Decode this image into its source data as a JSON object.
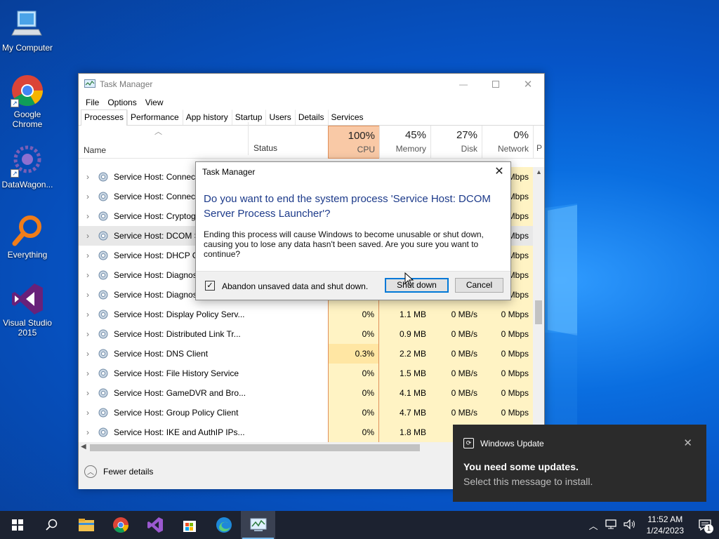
{
  "desktop": {
    "icons": [
      {
        "label": "My Computer"
      },
      {
        "label": "Google Chrome"
      },
      {
        "label": "DataWagon..."
      },
      {
        "label": "Everything"
      },
      {
        "label": "Visual Studio 2015"
      }
    ]
  },
  "taskmanager": {
    "title": "Task Manager",
    "menu": [
      "File",
      "Options",
      "View"
    ],
    "tabs": [
      "Processes",
      "Performance",
      "App history",
      "Startup",
      "Users",
      "Details",
      "Services"
    ],
    "columns": {
      "name": "Name",
      "status": "Status",
      "cpu": {
        "pct": "100%",
        "label": "CPU"
      },
      "memory": {
        "pct": "45%",
        "label": "Memory"
      },
      "disk": {
        "pct": "27%",
        "label": "Disk"
      },
      "network": {
        "pct": "0%",
        "label": "Network"
      },
      "power": "P"
    },
    "rows": [
      {
        "name": "Service Host: Connected...",
        "cpu": "",
        "mem": "",
        "disk": "",
        "net": "Mbps"
      },
      {
        "name": "Service Host: Connected...",
        "cpu": "",
        "mem": "",
        "disk": "",
        "net": "Mbps"
      },
      {
        "name": "Service Host: Cryptogr...",
        "cpu": "",
        "mem": "",
        "disk": "",
        "net": "Mbps"
      },
      {
        "name": "Service Host: DCOM S...",
        "cpu": "",
        "mem": "",
        "disk": "",
        "net": "Mbps"
      },
      {
        "name": "Service Host: DHCP Cl...",
        "cpu": "",
        "mem": "",
        "disk": "",
        "net": "Mbps"
      },
      {
        "name": "Service Host: Diagnost...",
        "cpu": "",
        "mem": "",
        "disk": "",
        "net": "Mbps"
      },
      {
        "name": "Service Host: Diagnost...",
        "cpu": "",
        "mem": "",
        "disk": "",
        "net": "Mbps"
      },
      {
        "name": "Service Host: Display Policy Serv...",
        "cpu": "0%",
        "mem": "1.1 MB",
        "disk": "0 MB/s",
        "net": "0 Mbps"
      },
      {
        "name": "Service Host: Distributed Link Tr...",
        "cpu": "0%",
        "mem": "0.9 MB",
        "disk": "0 MB/s",
        "net": "0 Mbps"
      },
      {
        "name": "Service Host: DNS Client",
        "cpu": "0.3%",
        "mem": "2.2 MB",
        "disk": "0 MB/s",
        "net": "0 Mbps"
      },
      {
        "name": "Service Host: File History Service",
        "cpu": "0%",
        "mem": "1.5 MB",
        "disk": "0 MB/s",
        "net": "0 Mbps"
      },
      {
        "name": "Service Host: GameDVR and Bro...",
        "cpu": "0%",
        "mem": "4.1 MB",
        "disk": "0 MB/s",
        "net": "0 Mbps"
      },
      {
        "name": "Service Host: Group Policy Client",
        "cpu": "0%",
        "mem": "4.7 MB",
        "disk": "0 MB/s",
        "net": "0 Mbps"
      },
      {
        "name": "Service Host: IKE and AuthIP IPs...",
        "cpu": "0%",
        "mem": "1.8 MB",
        "disk": "",
        "net": ""
      }
    ],
    "footer": "Fewer details"
  },
  "dialog": {
    "title": "Task Manager",
    "heading": "Do you want to end the system process 'Service Host: DCOM Server Process Launcher'?",
    "body": "Ending this process will cause Windows to become unusable or shut down, causing you to lose any data hasn't been saved. Are you sure you want to continue?",
    "checkbox_label": "Abandon unsaved data and shut down.",
    "checkbox_checked": true,
    "shutdown_label": "Shut down",
    "cancel_label": "Cancel"
  },
  "toast": {
    "app": "Windows Update",
    "heading": "You need some updates.",
    "message": "Select this message to install."
  },
  "taskbar": {
    "time": "11:52 AM",
    "date": "1/24/2023",
    "notification_count": "1",
    "accent": "#76b9ed"
  }
}
